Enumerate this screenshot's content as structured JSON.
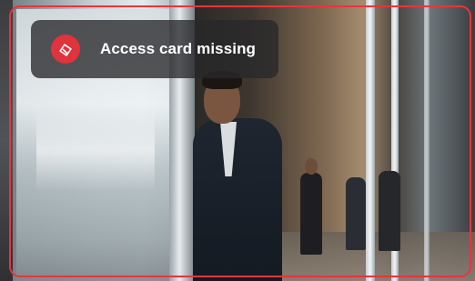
{
  "alert": {
    "message": "Access card missing",
    "icon": "access-card-alert-icon",
    "accent_color": "#e8343c",
    "icon_bg_color": "#e0333b"
  },
  "camera_view": {
    "subject": "person-on-phone-at-doorway"
  }
}
